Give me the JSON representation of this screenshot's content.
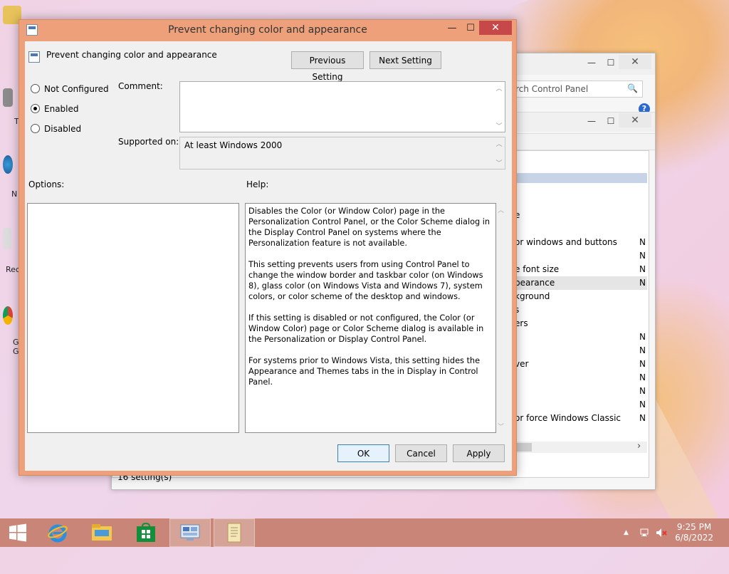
{
  "dialog": {
    "title": "Prevent changing color and appearance",
    "setting_name": "Prevent changing color and appearance",
    "prev_button": "Previous Setting",
    "next_button": "Next Setting",
    "states": [
      "Not Configured",
      "Enabled",
      "Disabled"
    ],
    "selected_state": "Enabled",
    "comment_label": "Comment:",
    "comment_value": "",
    "supported_label": "Supported on:",
    "supported_value": "At least Windows 2000",
    "options_label": "Options:",
    "help_label": "Help:",
    "help_paragraphs": [
      "Disables the Color (or Window Color) page in the Personalization Control Panel, or the Color Scheme dialog in the Display Control Panel on systems where the Personalization feature is not available.",
      "This setting prevents users from using Control Panel to change the window border and taskbar color (on Windows 8), glass color (on Windows Vista and Windows 7), system colors, or color scheme of the desktop and windows.",
      "If this setting is disabled or not configured, the Color (or Window Color) page or Color Scheme dialog is available in the Personalization or Display Control Panel.",
      "For systems prior to Windows Vista, this setting hides the Appearance and Themes tabs in the in Display in Control Panel."
    ],
    "ok_button": "OK",
    "cancel_button": "Cancel",
    "apply_button": "Apply",
    "minimize_glyph": "—",
    "maximize_glyph": "☐",
    "close_glyph": "✕"
  },
  "background_window": {
    "search_placeholder": "rch Control Panel",
    "search_icon": "🔍",
    "help_glyph": "?",
    "status": "16 setting(s)",
    "partial_rows": [
      {
        "text": "e",
        "n": ""
      },
      {
        "text": "or windows and buttons",
        "n": "N"
      },
      {
        "text": "",
        "n": "N"
      },
      {
        "text": "e font size",
        "n": "N"
      },
      {
        "text": "pearance",
        "n": "N"
      },
      {
        "text": "kground",
        "n": ""
      },
      {
        "text": "s",
        "n": ""
      },
      {
        "text": "ers",
        "n": ""
      },
      {
        "text": "",
        "n": "N"
      },
      {
        "text": "",
        "n": "N"
      },
      {
        "text": "ver",
        "n": "N"
      },
      {
        "text": "",
        "n": "N"
      },
      {
        "text": "",
        "n": "N"
      },
      {
        "text": "",
        "n": "N"
      },
      {
        "text": "or force Windows Classic",
        "n": "N"
      }
    ],
    "scroll_arrow": "›"
  },
  "desktop_icons": [
    {
      "label": "T"
    },
    {
      "label": "N"
    },
    {
      "label": "Rec"
    },
    {
      "label": "G\nG"
    }
  ],
  "taskbar": {
    "time": "9:25 PM",
    "date": "6/8/2022",
    "tray_arrow": "▲"
  },
  "colors": {
    "dialog_frame": "#eea07b",
    "close_red": "#c74848",
    "taskbar": "#c98577"
  }
}
